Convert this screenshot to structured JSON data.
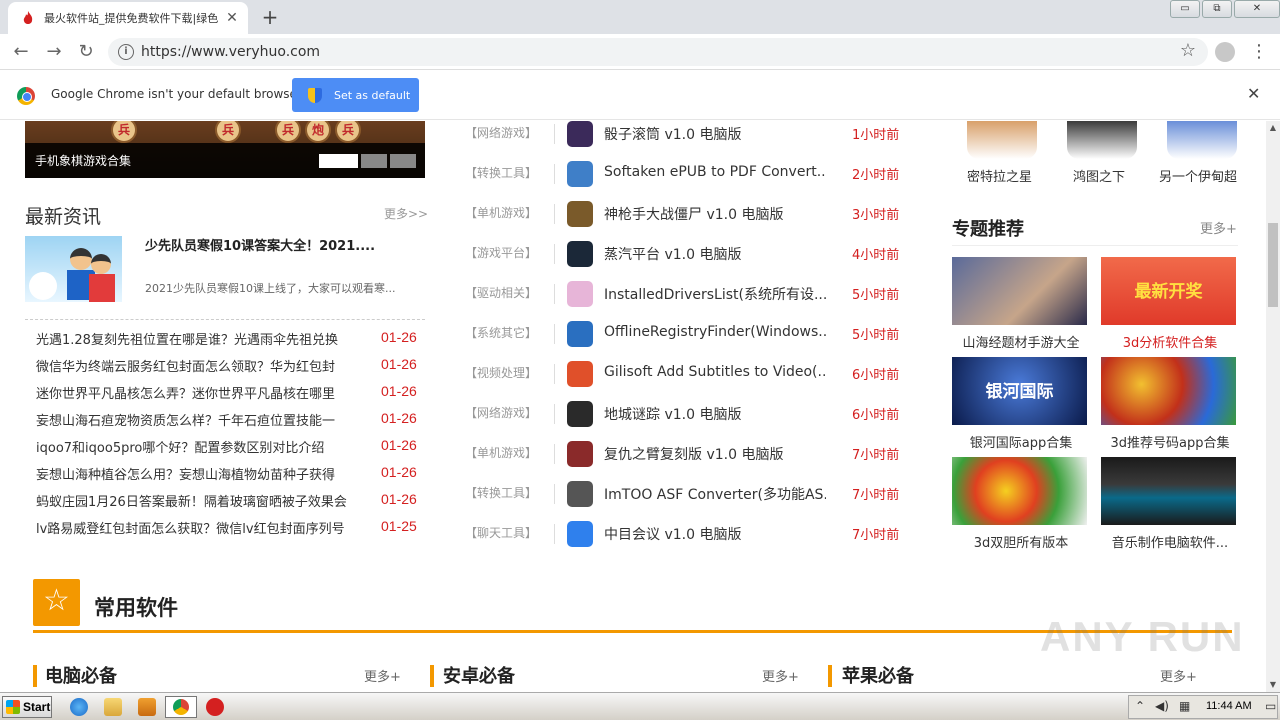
{
  "browser": {
    "tab_title": "最火软件站_提供免费软件下载|绿色",
    "tab_close": "✕",
    "new_tab": "+",
    "window_buttons": [
      "▭",
      "⧉",
      "✕"
    ],
    "url": "https://www.veryhuo.com",
    "back_icon": "←",
    "forward_icon": "→",
    "reload_icon": "↻",
    "star": "☆",
    "menu": "⋮"
  },
  "infobar": {
    "message": "Google Chrome isn't your default browser",
    "button": "Set as default",
    "close": "✕"
  },
  "banner": {
    "caption": "手机象棋游戏合集",
    "pieces": [
      "兵",
      "兵",
      "兵",
      "炮",
      "兵"
    ]
  },
  "news": {
    "title": "最新资讯",
    "more": "更多>>",
    "featured_title": "少先队员寒假10课答案大全！2021....",
    "featured_summary": "2021少先队员寒假10课上线了，大家可以观看寒...",
    "items": [
      {
        "title": "光遇1.28复刻先祖位置在哪是谁？光遇雨伞先祖兑换",
        "date": "01-26"
      },
      {
        "title": "微信华为终端云服务红包封面怎么领取？华为红包封",
        "date": "01-26"
      },
      {
        "title": "迷你世界平凡晶核怎么弄？迷你世界平凡晶核在哪里",
        "date": "01-26"
      },
      {
        "title": "妄想山海石疸宠物资质怎么样？千年石疸位置技能一",
        "date": "01-26"
      },
      {
        "title": "iqoo7和iqoo5pro哪个好？配置参数区别对比介绍",
        "date": "01-26"
      },
      {
        "title": "妄想山海种植谷怎么用？妄想山海植物幼苗种子获得",
        "date": "01-26"
      },
      {
        "title": "蚂蚁庄园1月26日答案最新！隔着玻璃窗晒被子效果会",
        "date": "01-26"
      },
      {
        "title": "lv路易威登红包封面怎么获取？微信lv红包封面序列号",
        "date": "01-25"
      }
    ]
  },
  "software": [
    {
      "cat": "【网络游戏】",
      "name": "骰子滚筒 v1.0 电脑版",
      "time": "1小时前",
      "color": "#3b2a5a"
    },
    {
      "cat": "【转换工具】",
      "name": "Softaken ePUB to PDF Convert...",
      "time": "2小时前",
      "color": "#3f7fc8"
    },
    {
      "cat": "【单机游戏】",
      "name": "神枪手大战僵尸 v1.0 电脑版",
      "time": "3小时前",
      "color": "#7a5a2a"
    },
    {
      "cat": "【游戏平台】",
      "name": "蒸汽平台 v1.0 电脑版",
      "time": "4小时前",
      "color": "#1b2838"
    },
    {
      "cat": "【驱动相关】",
      "name": "InstalledDriversList(系统所有设...",
      "time": "5小时前",
      "color": "#e7b5d8"
    },
    {
      "cat": "【系统其它】",
      "name": "OfflineRegistryFinder(Windows...",
      "time": "5小时前",
      "color": "#2a6fc0"
    },
    {
      "cat": "【视频处理】",
      "name": "Gilisoft Add Subtitles to Video(...",
      "time": "6小时前",
      "color": "#e0502a"
    },
    {
      "cat": "【网络游戏】",
      "name": "地城谜踪 v1.0 电脑版",
      "time": "6小时前",
      "color": "#2a2a2a"
    },
    {
      "cat": "【单机游戏】",
      "name": "复仇之臂复刻版 v1.0 电脑版",
      "time": "7小时前",
      "color": "#8a2a2a"
    },
    {
      "cat": "【转换工具】",
      "name": "ImTOO ASF Converter(多功能AS...",
      "time": "7小时前",
      "color": "#555555"
    },
    {
      "cat": "【聊天工具】",
      "name": "中目会议 v1.0 电脑版",
      "time": "7小时前",
      "color": "#2f80ed"
    }
  ],
  "games": [
    {
      "name": "密特拉之星",
      "color": "#d8a06a"
    },
    {
      "name": "鸿图之下",
      "color": "#3a3a3a"
    },
    {
      "name": "另一个伊甸超",
      "color": "#6a8fd8"
    }
  ],
  "topics": {
    "title": "专题推荐",
    "more": "更多+",
    "items": [
      {
        "label": "山海经题材手游大全",
        "highlight": false,
        "bg": "linear-gradient(135deg,#5a6a9a,#c6a58a 60%,#2a2a4a)",
        "img_text": ""
      },
      {
        "label": "3d分析软件合集",
        "highlight": true,
        "bg": "linear-gradient(#f16a4a,#e03a2a)",
        "img_text": "最新开奖"
      },
      {
        "label": "银河国际app合集",
        "highlight": false,
        "bg": "radial-gradient(circle at 50% 40%,#4a7ad8,#0a1a4a)",
        "img_text": "银河国际"
      },
      {
        "label": "3d推荐号码app合集",
        "highlight": false,
        "bg": "radial-gradient(circle at 30% 40%,#f2c030,#c2301a 40%,#2a6ad8 70%,#3a9a3a)",
        "img_text": ""
      },
      {
        "label": "3d双胆所有版本",
        "highlight": false,
        "bg": "radial-gradient(circle at 40% 50%,#f5d020,#e04020 35%,#3aa03a 60%,#f0f0f0)",
        "img_text": ""
      },
      {
        "label": "音乐制作电脑软件...",
        "highlight": false,
        "bg": "linear-gradient(#1a1a1a,#3a3a3a 40%,#0a6a8a 60%,#1a1a1a)",
        "img_text": ""
      }
    ]
  },
  "common": {
    "title": "常用软件",
    "sections": [
      {
        "title": "电脑必备",
        "more": "更多+"
      },
      {
        "title": "安卓必备",
        "more": "更多+"
      },
      {
        "title": "苹果必备",
        "more": "更多+"
      }
    ]
  },
  "watermark": "ANY RUN",
  "taskbar": {
    "start": "Start",
    "clock": "11:44 AM"
  }
}
